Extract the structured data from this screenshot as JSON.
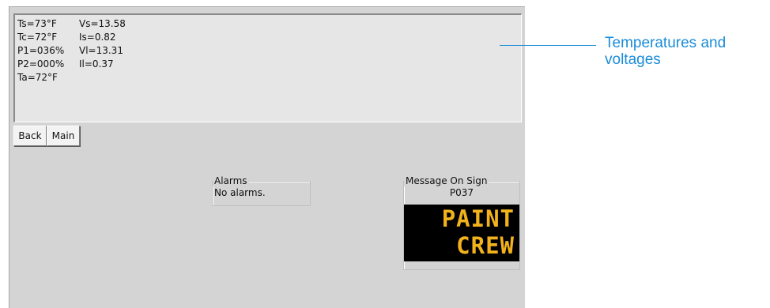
{
  "status": {
    "rows": [
      {
        "left": "Ts=73°F",
        "right": "Vs=13.58"
      },
      {
        "left": "Tc=72°F",
        "right": "Is=0.82"
      },
      {
        "left": "P1=036%",
        "right": "Vl=13.31"
      },
      {
        "left": "P2=000%",
        "right": "Il=0.37"
      },
      {
        "left": "Ta=72°F",
        "right": ""
      }
    ]
  },
  "buttons": {
    "back": "Back",
    "main": "Main"
  },
  "alarms": {
    "title": "Alarms",
    "text": "No alarms."
  },
  "sign": {
    "title": "Message On Sign",
    "code": "P037",
    "lines": [
      "PAINT",
      "CREW"
    ],
    "text_color": "#f2b21c",
    "background_color": "#000000"
  },
  "callout": {
    "text": "Temperatures and voltages",
    "color": "#1a8cd8"
  }
}
